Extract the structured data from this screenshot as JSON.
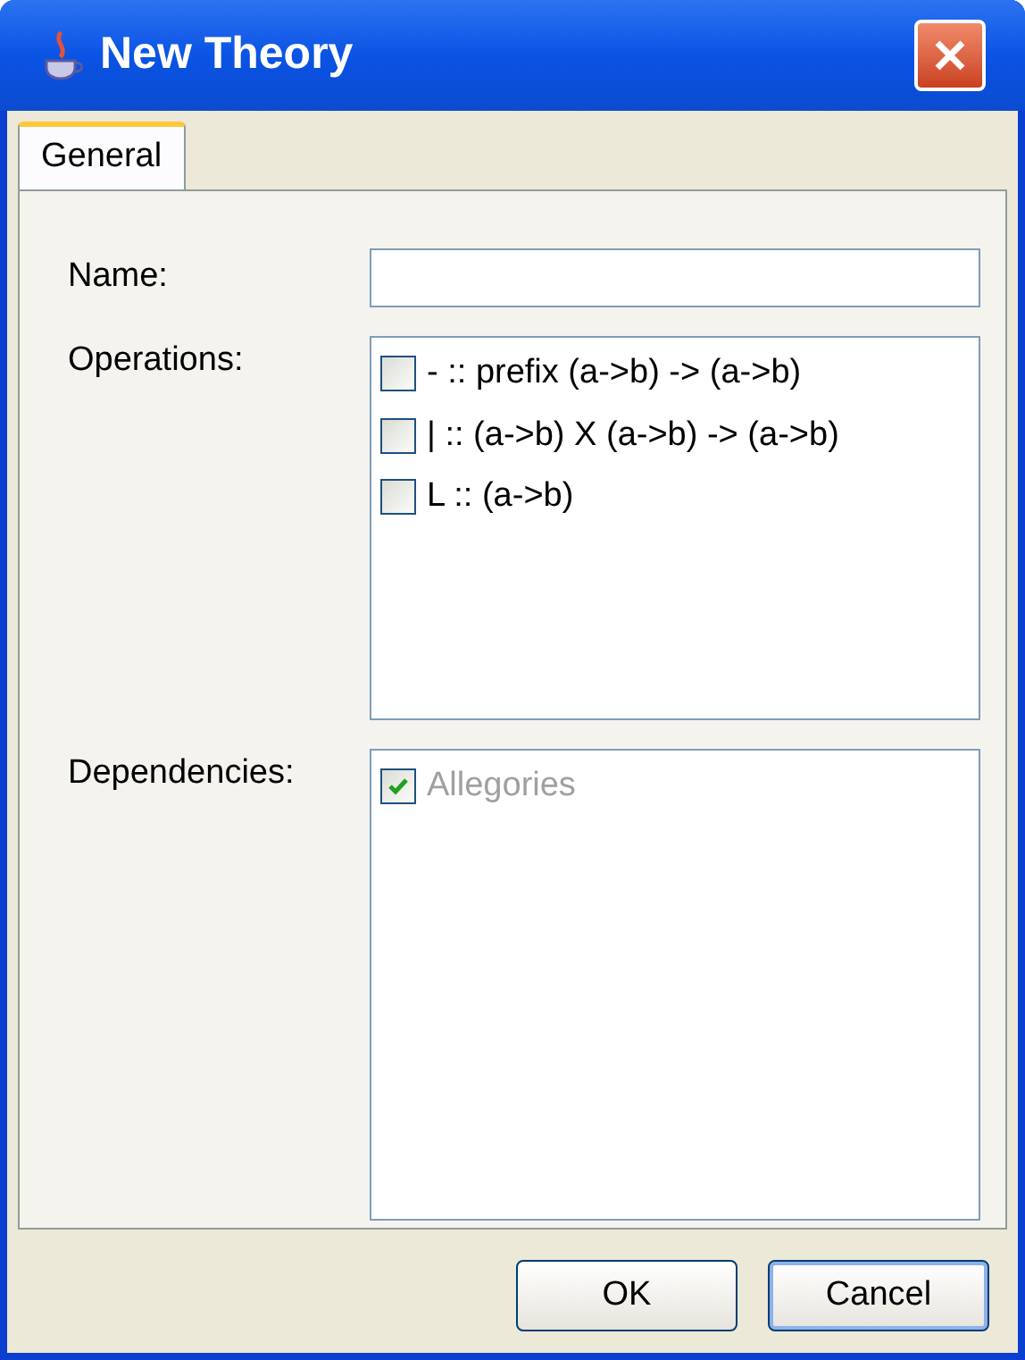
{
  "window": {
    "title": "New Theory"
  },
  "tabs": [
    {
      "label": "General",
      "selected": true
    }
  ],
  "name_field": {
    "label": "Name:"
  },
  "operations": {
    "label": "Operations:",
    "items": [
      {
        "label": "- :: prefix (a->b) -> (a->b)",
        "checked": false,
        "disabled": false
      },
      {
        "label": "| :: (a->b) X (a->b) -> (a->b)",
        "checked": false,
        "disabled": false
      },
      {
        "label": "L :: (a->b)",
        "checked": false,
        "disabled": false
      }
    ]
  },
  "dependencies": {
    "label": "Dependencies:",
    "items": [
      {
        "label": "Allegories",
        "checked": true,
        "disabled": true
      }
    ]
  },
  "buttons": [
    {
      "label": "OK",
      "selected": false
    },
    {
      "label": "Cancel",
      "selected": true
    }
  ]
}
